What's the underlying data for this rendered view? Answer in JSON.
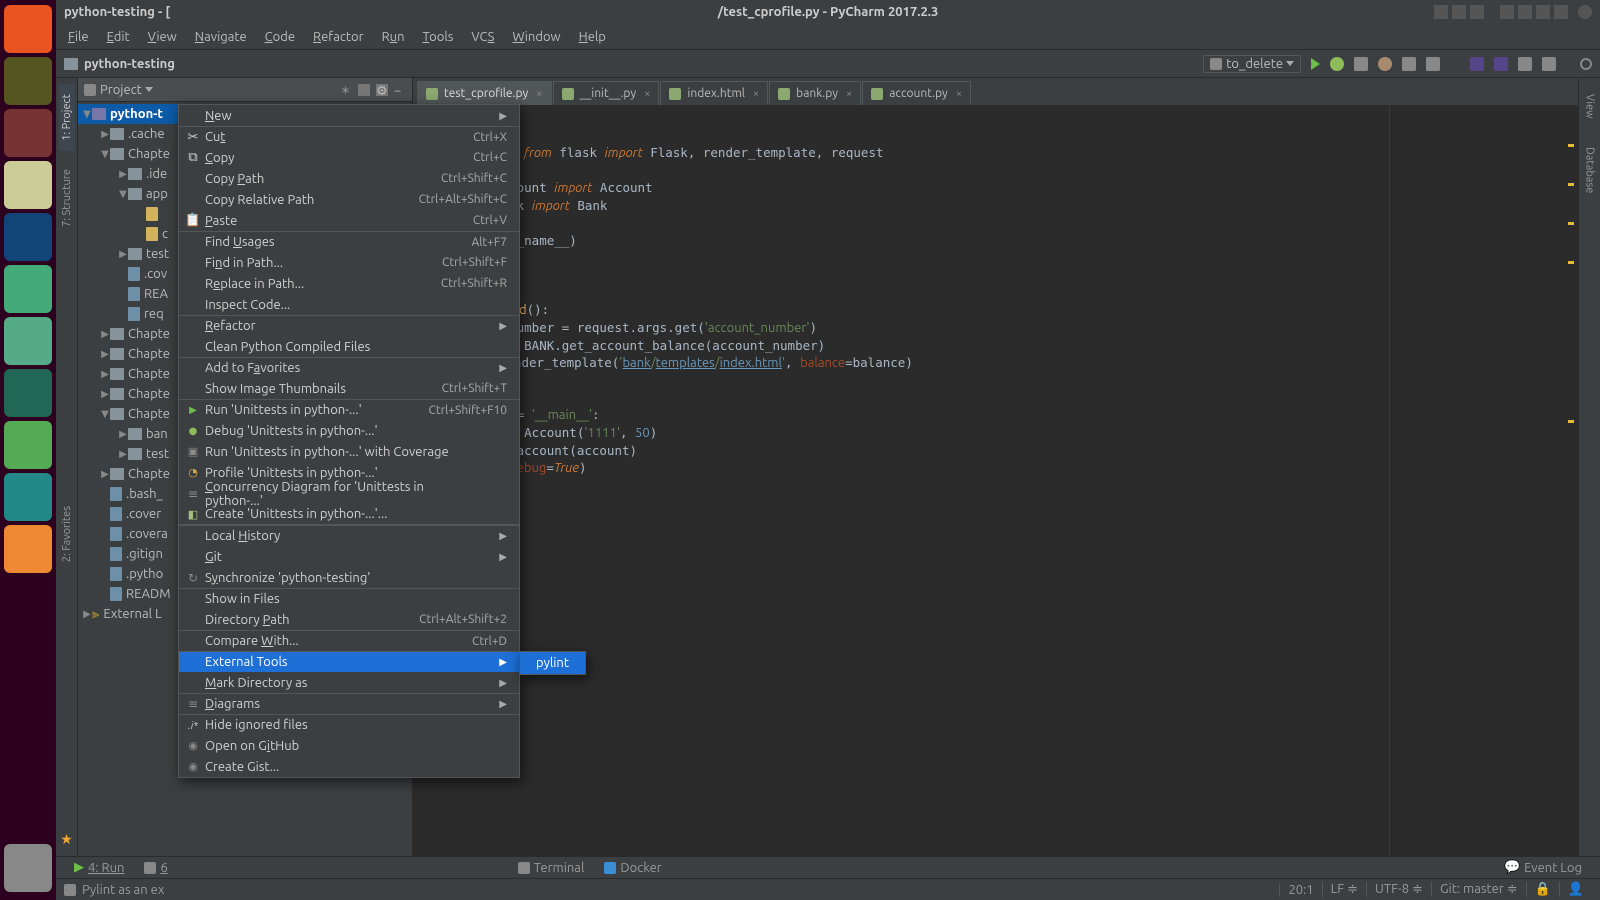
{
  "titlebar": {
    "project": "python-testing - [",
    "center": "/test_cprofile.py - PyCharm 2017.2.3"
  },
  "menubar": [
    "File",
    "Edit",
    "View",
    "Navigate",
    "Code",
    "Refactor",
    "Run",
    "Tools",
    "VCS",
    "Window",
    "Help"
  ],
  "breadcrumb": "python-testing",
  "run_config": "to_delete",
  "sidebar_tabs": {
    "project": "1: Project",
    "structure": "7: Structure",
    "favorites": "2: Favorites"
  },
  "project_header": "Project",
  "tree": {
    "root": "python-t",
    "items": [
      {
        "depth": 1,
        "label": ".cache",
        "exp": "▶",
        "type": "folder"
      },
      {
        "depth": 1,
        "label": "Chapte",
        "exp": "▼",
        "type": "folder"
      },
      {
        "depth": 2,
        "label": ".ide",
        "exp": "▶",
        "type": "folder"
      },
      {
        "depth": 2,
        "label": "app",
        "exp": "▼",
        "type": "folder"
      },
      {
        "depth": 3,
        "label": "",
        "exp": "",
        "type": "pyfile"
      },
      {
        "depth": 3,
        "label": "c",
        "exp": "",
        "type": "pyfile"
      },
      {
        "depth": 2,
        "label": "test",
        "exp": "▶",
        "type": "folder"
      },
      {
        "depth": 2,
        "label": ".cov",
        "exp": "",
        "type": "file"
      },
      {
        "depth": 2,
        "label": "REA",
        "exp": "",
        "type": "file"
      },
      {
        "depth": 2,
        "label": "req",
        "exp": "",
        "type": "file"
      },
      {
        "depth": 1,
        "label": "Chapte",
        "exp": "▶",
        "type": "folder"
      },
      {
        "depth": 1,
        "label": "Chapte",
        "exp": "▶",
        "type": "folder"
      },
      {
        "depth": 1,
        "label": "Chapte",
        "exp": "▶",
        "type": "folder"
      },
      {
        "depth": 1,
        "label": "Chapte",
        "exp": "▶",
        "type": "folder"
      },
      {
        "depth": 1,
        "label": "Chapte",
        "exp": "▼",
        "type": "folder"
      },
      {
        "depth": 2,
        "label": "ban",
        "exp": "▶",
        "type": "folder"
      },
      {
        "depth": 2,
        "label": "test",
        "exp": "▶",
        "type": "folder"
      },
      {
        "depth": 1,
        "label": "Chapte",
        "exp": "▶",
        "type": "folder"
      },
      {
        "depth": 1,
        "label": ".bash_",
        "exp": "",
        "type": "file"
      },
      {
        "depth": 1,
        "label": ".cover",
        "exp": "",
        "type": "file"
      },
      {
        "depth": 1,
        "label": ".covera",
        "exp": "",
        "type": "file"
      },
      {
        "depth": 1,
        "label": ".gitign",
        "exp": "",
        "type": "file"
      },
      {
        "depth": 1,
        "label": ".pytho",
        "exp": "",
        "type": "file"
      },
      {
        "depth": 1,
        "label": "READM",
        "exp": "",
        "type": "file"
      }
    ],
    "ext_libs": "External L"
  },
  "tabs": [
    {
      "label": "test_cprofile.py",
      "active": true
    },
    {
      "label": "__init__.py",
      "active": false
    },
    {
      "label": "index.html",
      "active": false
    },
    {
      "label": "bank.py",
      "active": false
    },
    {
      "label": "account.py",
      "active": false
    }
  ],
  "right_tabs": [
    "View",
    "Database"
  ],
  "context": {
    "items": [
      {
        "label": "New",
        "shortcut": "",
        "sub": true,
        "u": 0
      },
      {
        "label": "Cut",
        "shortcut": "Ctrl+X",
        "sep": true,
        "u": 2,
        "icon": "✂"
      },
      {
        "label": "Copy",
        "shortcut": "Ctrl+C",
        "u": 0,
        "icon": "⧉"
      },
      {
        "label": "Copy Path",
        "shortcut": "Ctrl+Shift+C",
        "u": 5
      },
      {
        "label": "Copy Relative Path",
        "shortcut": "Ctrl+Alt+Shift+C"
      },
      {
        "label": "Paste",
        "shortcut": "Ctrl+V",
        "u": 0,
        "icon": "📋"
      },
      {
        "label": "Find Usages",
        "shortcut": "Alt+F7",
        "sep": true,
        "u": 5
      },
      {
        "label": "Find in Path...",
        "shortcut": "Ctrl+Shift+F",
        "u": 2
      },
      {
        "label": "Replace in Path...",
        "shortcut": "Ctrl+Shift+R",
        "u": 1
      },
      {
        "label": "Inspect Code...",
        "shortcut": ""
      },
      {
        "label": "Refactor",
        "shortcut": "",
        "sub": true,
        "sep": true,
        "u": 0
      },
      {
        "label": "Clean Python Compiled Files",
        "shortcut": ""
      },
      {
        "label": "Add to Favorites",
        "shortcut": "",
        "sub": true,
        "sep": true,
        "u": 8
      },
      {
        "label": "Show Image Thumbnails",
        "shortcut": "Ctrl+Shift+T"
      },
      {
        "label": "Run 'Unittests in python-...'",
        "shortcut": "Ctrl+Shift+F10",
        "sep": true,
        "icon": "run"
      },
      {
        "label": "Debug 'Unittests in python-...'",
        "shortcut": "",
        "icon": "debug"
      },
      {
        "label": "Run 'Unittests in python-...' with Coverage",
        "shortcut": "",
        "icon": "cov"
      },
      {
        "label": "Profile 'Unittests in python-...'",
        "shortcut": "",
        "icon": "profile"
      },
      {
        "label": "Concurrency Diagram for  'Unittests in python-...'",
        "shortcut": "",
        "icon": "diag",
        "u": 0
      },
      {
        "label": "Create 'Unittests in python-...'...",
        "shortcut": "",
        "icon": "file",
        "sep2": true
      },
      {
        "label": "Local History",
        "shortcut": "",
        "sub": true,
        "sep": true,
        "u": 6
      },
      {
        "label": "Git",
        "shortcut": "",
        "sub": true,
        "u": 0
      },
      {
        "label": "Synchronize 'python-testing'",
        "shortcut": "",
        "u": 1,
        "icon": "refresh"
      },
      {
        "label": "Show in Files",
        "shortcut": "",
        "sep": true
      },
      {
        "label": "Directory Path",
        "shortcut": "Ctrl+Alt+Shift+2",
        "u": 10
      },
      {
        "label": "Compare With...",
        "shortcut": "Ctrl+D",
        "sep": true,
        "u": 8
      },
      {
        "label": "External Tools",
        "shortcut": "",
        "sub": true,
        "hl": true,
        "sep": true
      },
      {
        "label": "Mark Directory as",
        "shortcut": "",
        "sub": true,
        "u": 0
      },
      {
        "label": "Diagrams",
        "shortcut": "",
        "sub": true,
        "sep": true,
        "u": 0,
        "icon": "diag"
      },
      {
        "label": "Hide ignored files",
        "shortcut": "",
        "sep": true,
        "preicon": ".i*"
      },
      {
        "label": "Open on GitHub",
        "shortcut": "",
        "u": 9,
        "icon": "gh"
      },
      {
        "label": "Create Gist...",
        "shortcut": "",
        "icon": "gh"
      }
    ],
    "submenu_item": "pylint"
  },
  "bottom": {
    "run": "4: Run",
    "six": "6",
    "terminal": "Terminal",
    "docker": "Docker",
    "eventlog": "Event Log"
  },
  "status": {
    "msg": "Pylint as an ex",
    "pos": "20:1",
    "lf": "LF",
    "enc": "UTF-8",
    "git": "Git: master"
  }
}
